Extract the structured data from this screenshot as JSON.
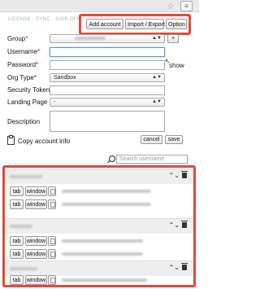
{
  "browser": {
    "star_icon": "☆",
    "menu_icon": "≡"
  },
  "toolbar": {
    "links_label": "LICENSE · SYNC · SIGN OFF",
    "add_account": "Add account",
    "import_export": "Import / Export",
    "option": "Option"
  },
  "form": {
    "group_label": "Group",
    "username_label": "Username",
    "password_label": "Password",
    "show_label": "show",
    "org_type_label": "Org Type",
    "org_type_value": "Sandbox",
    "security_token_label": "Security Token",
    "landing_page_label": "Landing Page",
    "landing_page_value": "-",
    "description_label": "Description",
    "add_group_label": "+",
    "required_mark": "*",
    "copy_account_info": "Copy account info",
    "cancel": "cancel",
    "save": "save"
  },
  "search": {
    "placeholder": "Search username"
  },
  "list": {
    "controls": "⌃⌄",
    "tab_label": "tab",
    "window_label": "window"
  },
  "colors": {
    "highlight": "#e24a37",
    "required": "#cc0000",
    "focus": "#5b9dd9"
  }
}
